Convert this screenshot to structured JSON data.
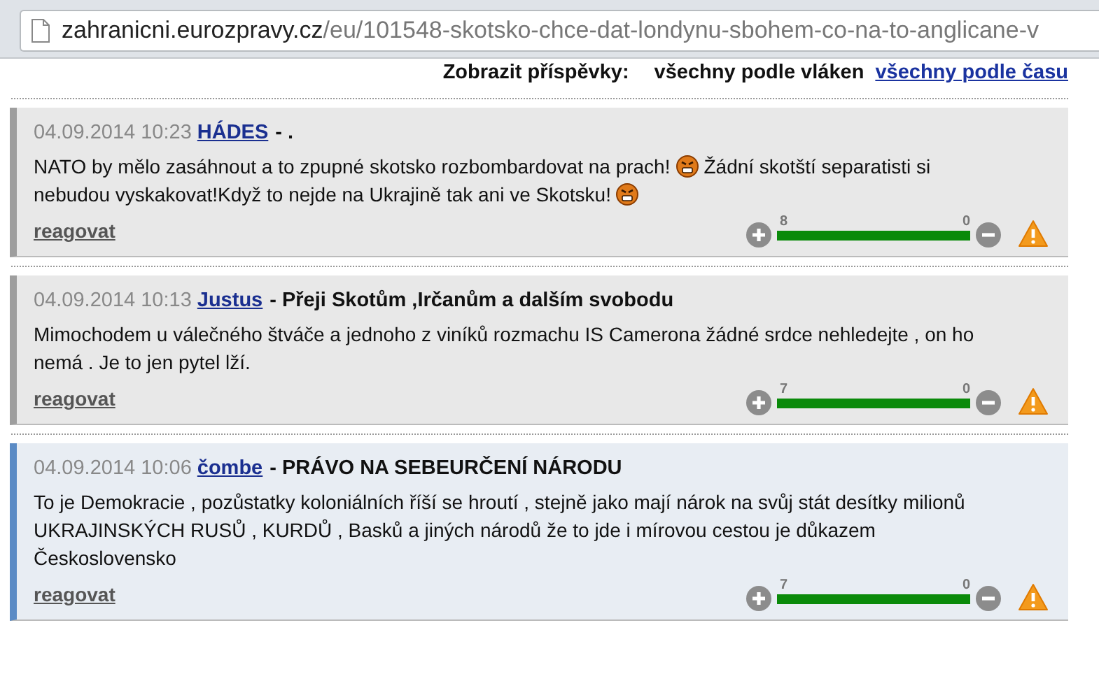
{
  "address_bar": {
    "host": "zahranicni.eurozpravy.cz",
    "path": "/eu/101548-skotsko-chce-dat-londynu-sbohem-co-na-to-anglicane-v"
  },
  "sort": {
    "label": "Zobrazit příspěvky:",
    "options": [
      {
        "label": "všechny podle vláken",
        "selected": true
      },
      {
        "label": "všechny podle času",
        "selected": false
      }
    ]
  },
  "comments": [
    {
      "date": "04.09.2014 10:23",
      "author": "HÁDES",
      "title": "- .",
      "highlighted": false,
      "body": [
        {
          "kind": "text",
          "text": "NATO by mělo zasáhnout a to zpupné skotsko rozbombardovat na prach!"
        },
        {
          "kind": "emoji"
        },
        {
          "kind": "text",
          "text": "Žádní skotští separatisti si"
        },
        {
          "kind": "text",
          "text": "nebudou vyskakovat!Když to nejde na Ukrajině tak ani ve Skotsku!"
        },
        {
          "kind": "emoji"
        }
      ],
      "reply": "reagovat",
      "plus": "8",
      "minus": "0",
      "level": 1
    },
    {
      "date": "04.09.2014 10:13",
      "author": "Justus",
      "title": "- Přeji Skotům ,Irčanům a dalším svobodu",
      "highlighted": false,
      "body": [
        {
          "kind": "text",
          "text": "Mimochodem u válečného štváče a jednoho z viníků rozmachu IS Camerona žádné srdce nehledejte , on ho nemá . Je to jen pytel lží."
        }
      ],
      "reply": "reagovat",
      "plus": "7",
      "minus": "0",
      "level": 1
    },
    {
      "date": "04.09.2014 10:06",
      "author": "čombe",
      "title": "- PRÁVO NA SEBEURČENÍ NÁRODU",
      "highlighted": true,
      "body": [
        {
          "kind": "text",
          "text": "To je Demokracie , pozůstatky koloniálních říší se hroutí , stejně jako mají nárok na svůj stát desítky milionů UKRAJINSKÝCH RUSŮ , KURDŮ , Basků a jiných národů že to jde i mírovou cestou je důkazem Československo"
        }
      ],
      "reply": "reagovat",
      "plus": "7",
      "minus": "0",
      "level": 1
    }
  ]
}
